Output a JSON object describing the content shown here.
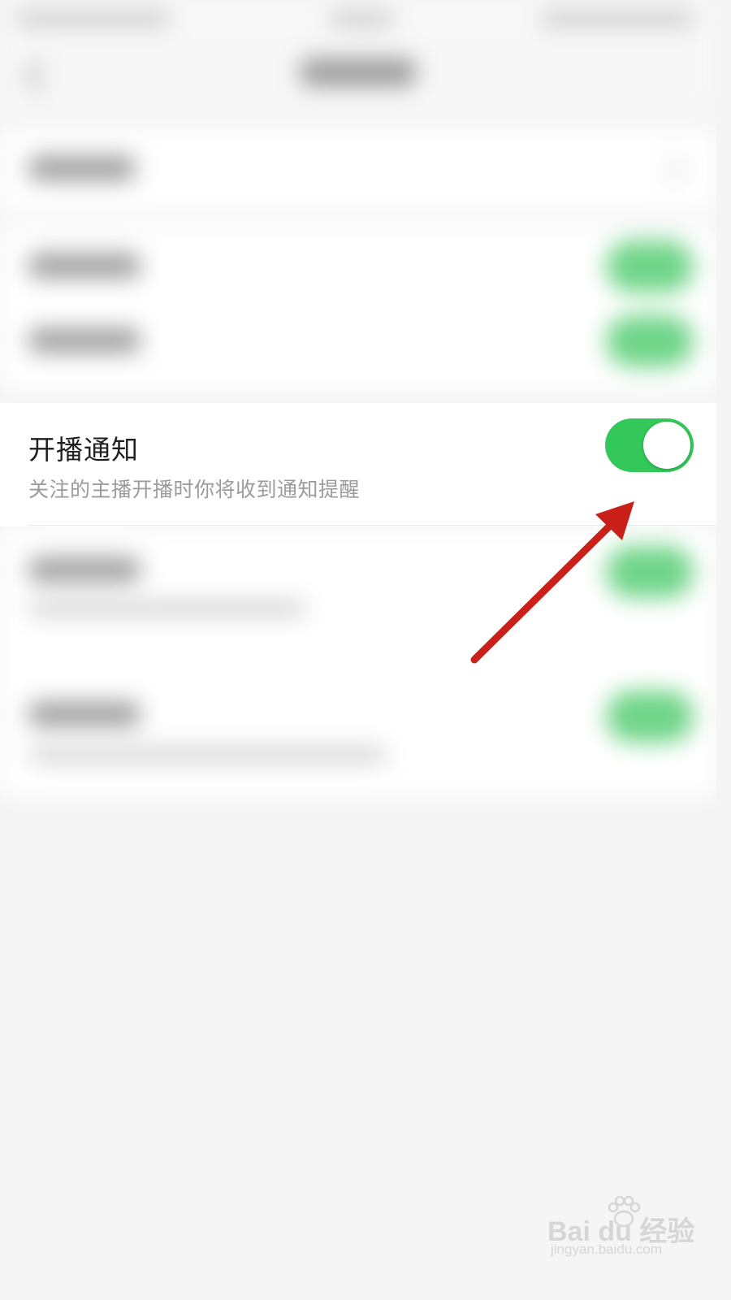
{
  "setting": {
    "title": "开播通知",
    "description": "关注的主播开播时你将收到通知提醒",
    "toggle_on": true,
    "toggle_color": "#34c759"
  },
  "annotation": {
    "arrow_color": "#c9201a"
  },
  "watermark": {
    "logo_text": "Bai  du 经验",
    "url": "jingyan.baidu.com"
  }
}
